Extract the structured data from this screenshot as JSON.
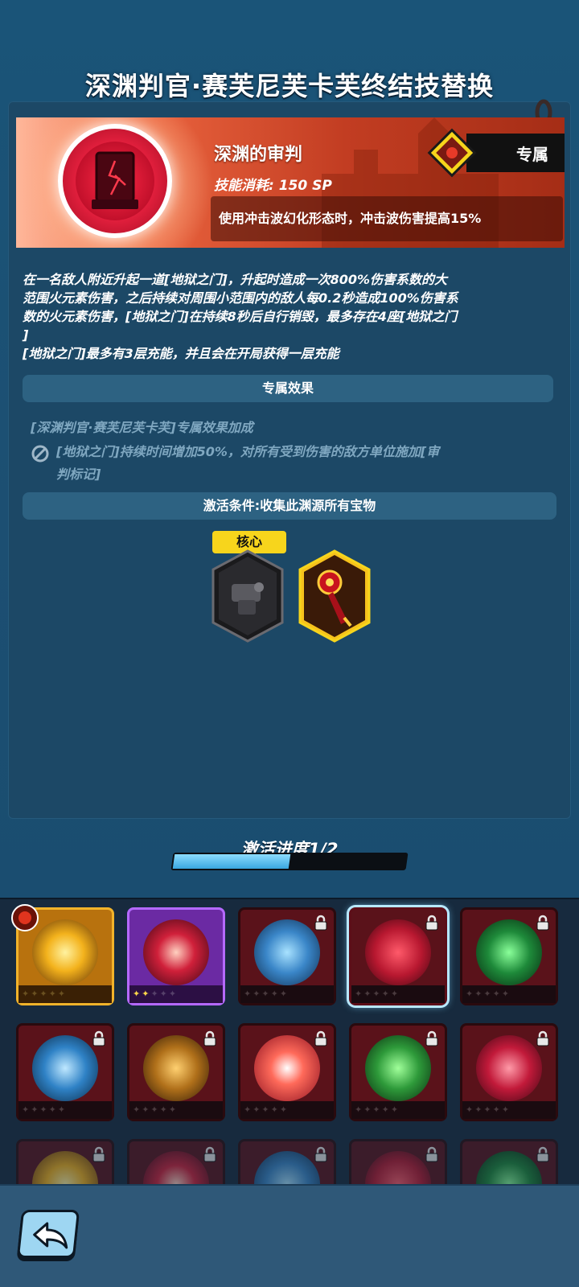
{
  "title": "深渊判官·赛芙尼芙卡芙终结技替换",
  "skill": {
    "name": "深渊的审判",
    "cost": "技能消耗: 150 SP",
    "effect": "使用冲击波幻化形态时，冲击波伤害提高15%",
    "exclusive_label": "专属",
    "emblem_icon": "hell-gate-icon"
  },
  "description": [
    "在一名敌人附近升起一道[地狱之门]，升起时造成一次800%伤害系数的大",
    "范围火元素伤害，之后持续对周围小范围内的敌人每0.2秒造成100%伤害系",
    "数的火元素伤害，[地狱之门]在持续8秒后自行销毁，最多存在4座[地狱之门",
    "]",
    "[地狱之门]最多有3层充能，并且会在开局获得一层充能"
  ],
  "exclusive": {
    "header": "专属效果",
    "bonus_title": "[深渊判官·赛芙尼芙卡芙]专属效果加成",
    "bonus_lines": [
      "[地狱之门]持续时间增加50%，对所有受到伤害的敌方单位施加[审",
      "判标记]"
    ]
  },
  "activation": {
    "header": "激活条件:收集此渊源所有宝物",
    "core_tag": "核心",
    "treasures": [
      {
        "name": "dark-gauntlet-icon",
        "collected": false,
        "core": true
      },
      {
        "name": "fire-scepter-icon",
        "collected": true,
        "core": false
      }
    ],
    "progress_label": "激活进度1/2",
    "progress_value": 0.5
  },
  "skill_grid": [
    {
      "icon": "lightning-icon",
      "style": "gold",
      "locked": false,
      "stars": 0
    },
    {
      "icon": "flame-wisp-icon",
      "style": "purple",
      "locked": false,
      "stars": 2
    },
    {
      "icon": "ice-shard-icon",
      "style": "red",
      "locked": true,
      "stars": 0
    },
    {
      "icon": "hell-gate-icon",
      "style": "red",
      "locked": true,
      "stars": 0,
      "selected": true
    },
    {
      "icon": "dragon-head-icon",
      "style": "red",
      "locked": true,
      "stars": 0
    },
    {
      "icon": "ice-castle-icon",
      "style": "red",
      "locked": true,
      "stars": 0
    },
    {
      "icon": "vortex-icon",
      "style": "red",
      "locked": true,
      "stars": 0
    },
    {
      "icon": "explosion-icon",
      "style": "red",
      "locked": true,
      "stars": 0
    },
    {
      "icon": "green-spirit-icon",
      "style": "red",
      "locked": true,
      "stars": 0
    },
    {
      "icon": "crimson-lotus-icon",
      "style": "red",
      "locked": true,
      "stars": 0
    }
  ],
  "colors": {
    "accent_yellow": "#f7d51c",
    "progress": "#58c0f0",
    "banner": "#c23d22"
  }
}
